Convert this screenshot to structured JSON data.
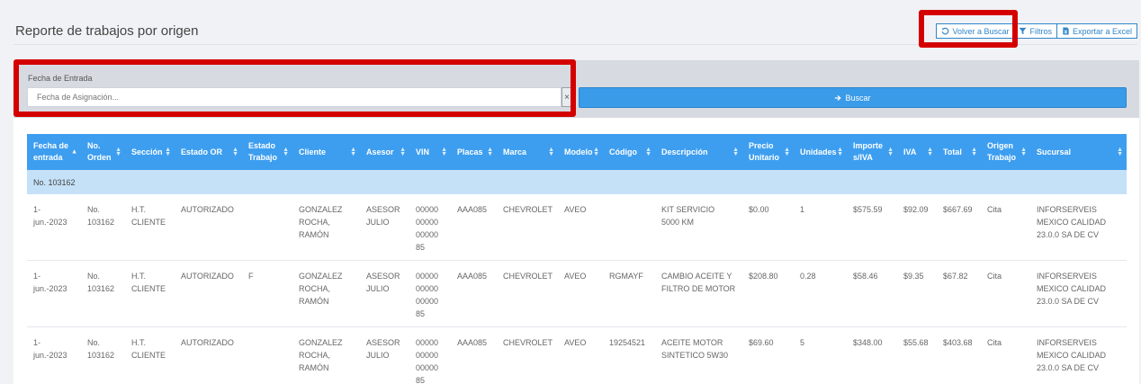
{
  "page": {
    "title": "Reporte de trabajos por origen"
  },
  "toolbar": {
    "back_label": "Volver a Buscar",
    "filters_label": "Filtros",
    "export_label": "Exportar a Excel"
  },
  "filter": {
    "label": "Fecha de Entrada",
    "date_placeholder": "Fecha de Asignación...",
    "clear_label": "×",
    "search_label": "Buscar"
  },
  "table": {
    "columns": [
      "Fecha de entrada",
      "No. Orden",
      "Sección",
      "Estado OR",
      "Estado Trabajo",
      "Cliente",
      "Asesor",
      "VIN",
      "Placas",
      "Marca",
      "Modelo",
      "Código",
      "Descripción",
      "Precio Unitario",
      "Unidades",
      "Importe s/IVA",
      "IVA",
      "Total",
      "Origen Trabajo",
      "Sucursal"
    ],
    "group_label": "No. 103162",
    "rows": [
      [
        "1-\njun.-2023",
        "No.\n103162",
        "H.T.\nCLIENTE",
        "AUTORIZADO",
        "",
        "GONZALEZ\nROCHA,\nRAMÓN",
        "ASESOR\nJULIO",
        "00000\n00000\n00000\n85",
        "AAA085",
        "CHEVROLET",
        "AVEO",
        "",
        "KIT SERVICIO\n5000 KM",
        "$0.00",
        "1",
        "$575.59",
        "$92.09",
        "$667.69",
        "Cita",
        "INFORSERVEIS\nMEXICO CALIDAD\n23.0.0 SA DE CV"
      ],
      [
        "1-\njun.-2023",
        "No.\n103162",
        "H.T.\nCLIENTE",
        "AUTORIZADO",
        "F",
        "GONZALEZ\nROCHA,\nRAMÓN",
        "ASESOR\nJULIO",
        "00000\n00000\n00000\n85",
        "AAA085",
        "CHEVROLET",
        "AVEO",
        "RGMAYF",
        "CAMBIO ACEITE Y\nFILTRO DE MOTOR",
        "$208.80",
        "0.28",
        "$58.46",
        "$9.35",
        "$67.82",
        "Cita",
        "INFORSERVEIS\nMEXICO CALIDAD\n23.0.0 SA DE CV"
      ],
      [
        "1-\njun.-2023",
        "No.\n103162",
        "H.T.\nCLIENTE",
        "AUTORIZADO",
        "",
        "GONZALEZ\nROCHA,\nRAMÓN",
        "ASESOR\nJULIO",
        "00000\n00000\n00000\n85",
        "AAA085",
        "CHEVROLET",
        "AVEO",
        "19254521",
        "ACEITE MOTOR\nSINTETICO 5W30",
        "$69.60",
        "5",
        "$348.00",
        "$55.68",
        "$403.68",
        "Cita",
        "INFORSERVEIS\nMEXICO CALIDAD\n23.0.0 SA DE CV"
      ]
    ]
  },
  "colors": {
    "header_bg": "#3d9ef0",
    "group_bg": "#c4e1f8",
    "search_button": "#3a9be8",
    "highlight": "#d40000"
  },
  "icons": {
    "back": "rotate-left-icon",
    "filters": "filter-icon",
    "export": "file-excel-icon",
    "search": "arrow-right-icon",
    "sort": "sort-icon"
  }
}
